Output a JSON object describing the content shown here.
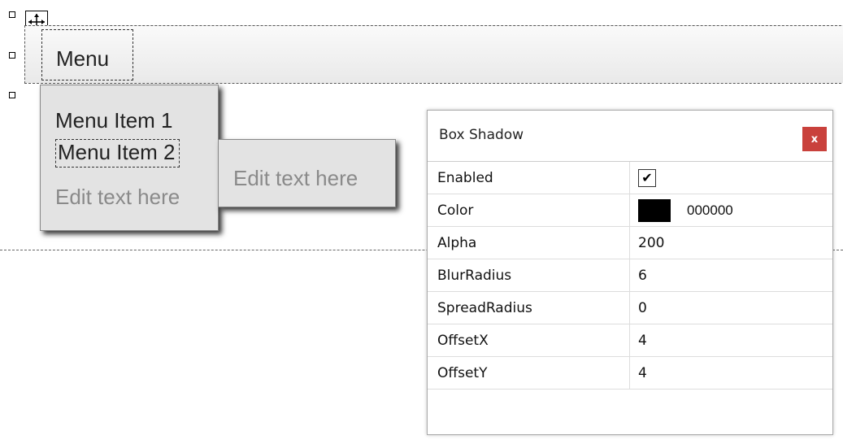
{
  "menubar": {
    "menu_label": "Menu"
  },
  "dropdown": {
    "items": [
      "Menu Item 1",
      "Menu Item 2"
    ],
    "placeholder": "Edit text here"
  },
  "submenu": {
    "placeholder": "Edit text here"
  },
  "panel": {
    "title": "Box Shadow",
    "close_label": "x",
    "close_color": "#c9413c",
    "rows": [
      {
        "name": "Enabled",
        "value": "✔"
      },
      {
        "name": "Color",
        "value": "000000",
        "swatch": "#000000"
      },
      {
        "name": "Alpha",
        "value": "200"
      },
      {
        "name": "BlurRadius",
        "value": "6"
      },
      {
        "name": "SpreadRadius",
        "value": "0"
      },
      {
        "name": "OffsetX",
        "value": "4"
      },
      {
        "name": "OffsetY",
        "value": "4"
      }
    ]
  }
}
